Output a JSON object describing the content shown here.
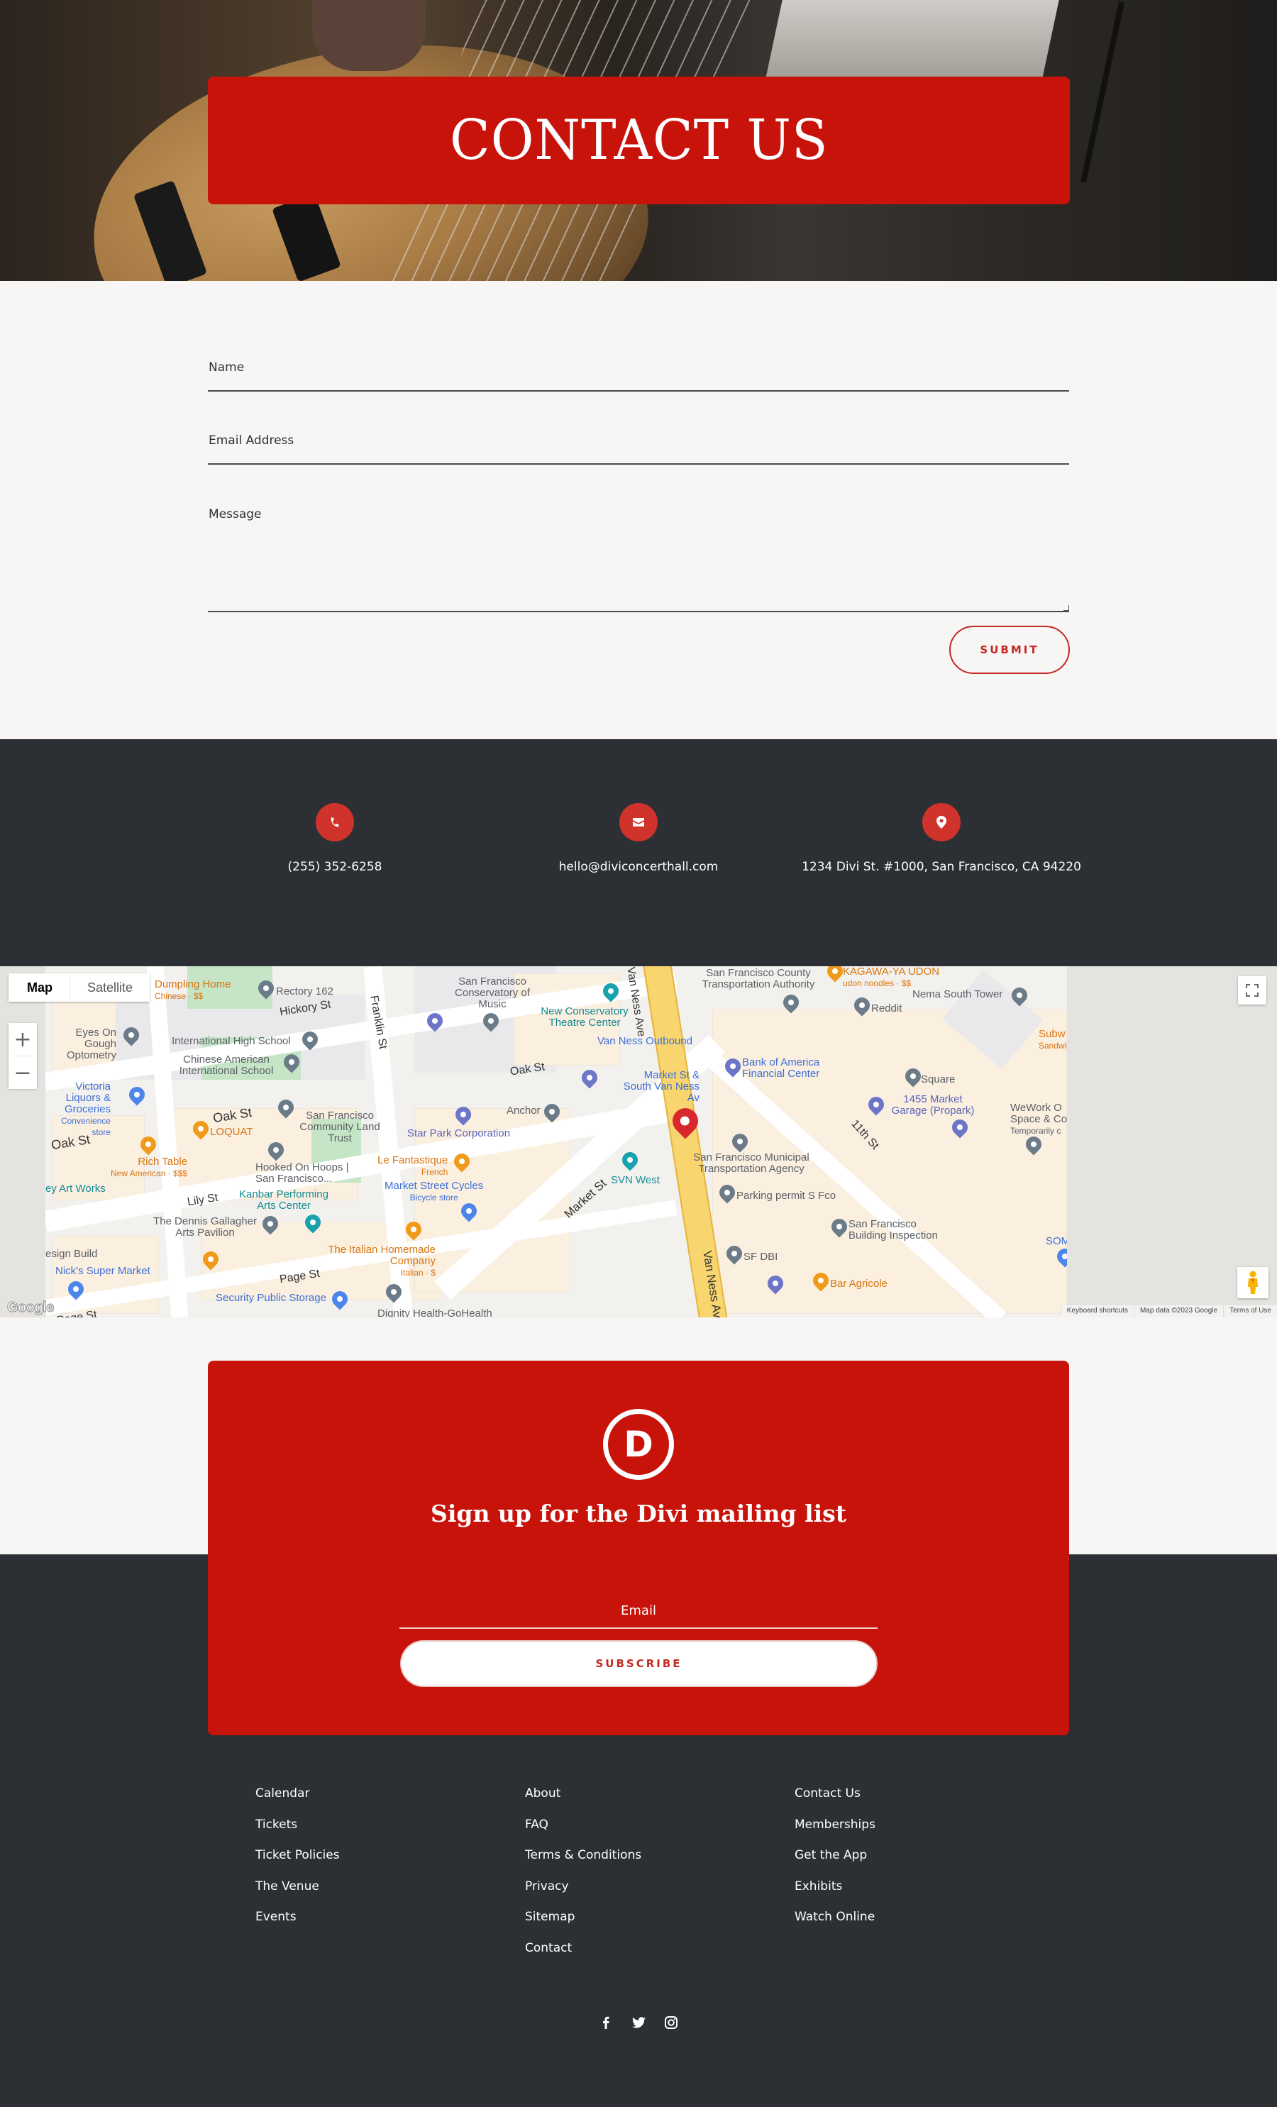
{
  "hero": {
    "title": "CONTACT US"
  },
  "form": {
    "name_label": "Name",
    "email_label": "Email Address",
    "message_label": "Message",
    "submit_label": "SUBMIT"
  },
  "contact_info": [
    {
      "icon": "phone-icon",
      "text": "(255) 352-6258"
    },
    {
      "icon": "envelope-icon",
      "text": "hello@diviconcerthall.com"
    },
    {
      "icon": "location-pin-icon",
      "text": "1234 Divi St. #1000, San Francisco, CA 94220"
    }
  ],
  "map": {
    "type_buttons": [
      "Map",
      "Satellite"
    ],
    "active_type": "Map",
    "zoom_in": "+",
    "zoom_out": "−",
    "google_logo": "Google",
    "attribution": [
      "Keyboard shortcuts",
      "Map data ©2023 Google",
      "Terms of Use"
    ],
    "streets": [
      "Hickory St",
      "Franklin St",
      "Oak St",
      "Oak St",
      "Oak St",
      "Lily St",
      "Page St",
      "Page St",
      "Market St",
      "Van Ness Ave",
      "Van Ness Ave",
      "11th St"
    ],
    "places": {
      "dumpling_home": "Dumpling Home",
      "dumpling_home_sub": "Chinese · $$",
      "rectory": "Rectory 162",
      "eyes_on_gough": "Eyes On Gough Optometry",
      "intl_high_school": "International High School",
      "chinese_american": "Chinese American International School",
      "victoria_liquors": "Victoria Liquors & Groceries",
      "victoria_sub": "Convenience store",
      "loquat": "LOQUAT",
      "rich_table": "Rich Table",
      "rich_table_sub": "New American · $$$",
      "sf_land_trust": "San Francisco Community Land Trust",
      "hooked_on_hoops": "Hooked On Hoops | San Francisco...",
      "art_works": "ey Art Works",
      "kanbar": "Kanbar Performing Arts Center",
      "dennis_gallagher": "The Dennis Gallagher Arts Pavilion",
      "design_build": "esign Build",
      "nicks": "Nick's Super Market",
      "security_storage": "Security Public Storage",
      "dignity_health": "Dignity Health-GoHealth",
      "italian_homemade": "The Italian Homemade Company",
      "italian_sub": "Italian · $",
      "le_fantastique": "Le Fantastique",
      "le_fantastique_sub": "French",
      "market_cycles": "Market Street Cycles",
      "market_cycles_sub": "Bicycle store",
      "star_park": "Star Park Corporation",
      "anchor": "Anchor",
      "sf_conservatory": "San Francisco Conservatory of Music",
      "new_conservatory": "New Conservatory Theatre Center",
      "van_ness_outbound": "Van Ness Outbound",
      "market_south_van_ness": "Market St & South Van Ness Av",
      "svn_west": "SVN West",
      "sfcta": "San Francisco County Transportation Authority",
      "kagawa": "KAGAWA-YA UDON",
      "kagawa_sub": "udon noodles · $$",
      "reddit": "Reddit",
      "nema": "Nema South Tower",
      "bank_of_america": "Bank of America Financial Center",
      "square": "Square",
      "garage_1455": "1455 Market Garage (Propark)",
      "wework": "WeWork O Space & Co",
      "wework_sub": "Temporarily c",
      "subway": "Subw",
      "subway_sub": "Sandwic",
      "sfmta": "San Francisco Municipal Transportation Agency",
      "parking_permit": "Parking permit S Fco",
      "sf_dbi": "SF DBI",
      "sf_building": "San Francisco Building Inspection",
      "bar_agricole": "Bar Agricole",
      "som": "SOM"
    }
  },
  "newsletter": {
    "logo_letter": "D",
    "title": "Sign up for the Divi mailing list",
    "email_placeholder": "Email",
    "subscribe_label": "SUBSCRIBE"
  },
  "footer": {
    "columns": [
      [
        "Calendar",
        "Tickets",
        "Ticket Policies",
        "The Venue",
        "Events"
      ],
      [
        "About",
        "FAQ",
        "Terms & Conditions",
        "Privacy",
        "Sitemap",
        "Contact"
      ],
      [
        "Contact Us",
        "Memberships",
        "Get the App",
        "Exhibits",
        "Watch Online"
      ]
    ],
    "social": [
      "facebook-icon",
      "twitter-icon",
      "instagram-icon"
    ]
  },
  "colors": {
    "brand_red": "#c8130b",
    "accent_red": "#d0332c",
    "dark_bg": "#2c2f33",
    "light_bg": "#f8f5f5"
  }
}
